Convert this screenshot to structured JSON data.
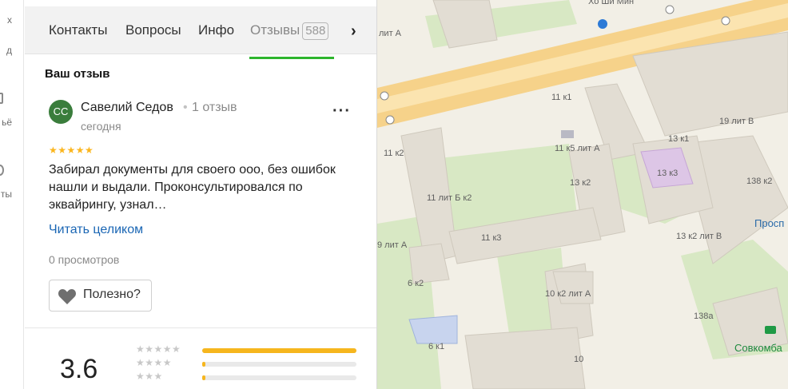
{
  "edge": {
    "fragments": [
      "х",
      "д",
      "ьё",
      "ты"
    ]
  },
  "tabs": [
    {
      "label": "Контакты"
    },
    {
      "label": "Вопросы"
    },
    {
      "label": "Инфо"
    },
    {
      "label": "Отзывы",
      "count": "588"
    }
  ],
  "section_title": "Ваш отзыв",
  "review": {
    "avatar": "СС",
    "author": "Савелий Седов",
    "author_dot": "•",
    "author_count": "1 отзыв",
    "date": "сегодня",
    "stars": "★★★★★",
    "text": "Забирал документы для своего ооо, без ошибок нашли и выдали. Проконсультировался по эквайрингу, узнал…",
    "read_more": "Читать целиком",
    "views": "0 просмотров",
    "useful": "Полезно?"
  },
  "rating": {
    "value": "3.6",
    "distribution": [
      {
        "stars": "★★★★★",
        "fraction": 1.0
      },
      {
        "stars": "★★★★",
        "fraction": 0.02
      },
      {
        "stars": "★★★",
        "fraction": 0.02
      }
    ]
  },
  "map": {
    "street": "Хо Ши Мин",
    "poi": "Просп",
    "bank": "Совкомба",
    "buildings": [
      "лит А",
      "11 к1",
      "19 лит В",
      "11 к5 лит А",
      "13 к1",
      "11 к2",
      "13 к3",
      "138 к2",
      "13 к2",
      "11 лит Б к2",
      "11 к3",
      "13 к2 лит В",
      "9 лит А",
      "6 к2",
      "10 к2 лит А",
      "138а",
      "6 к1",
      "10"
    ]
  },
  "colors": {
    "accent_green": "#2db52d",
    "avatar": "#3a7d3c",
    "link": "#1a66b4",
    "star": "#fbb61e"
  }
}
